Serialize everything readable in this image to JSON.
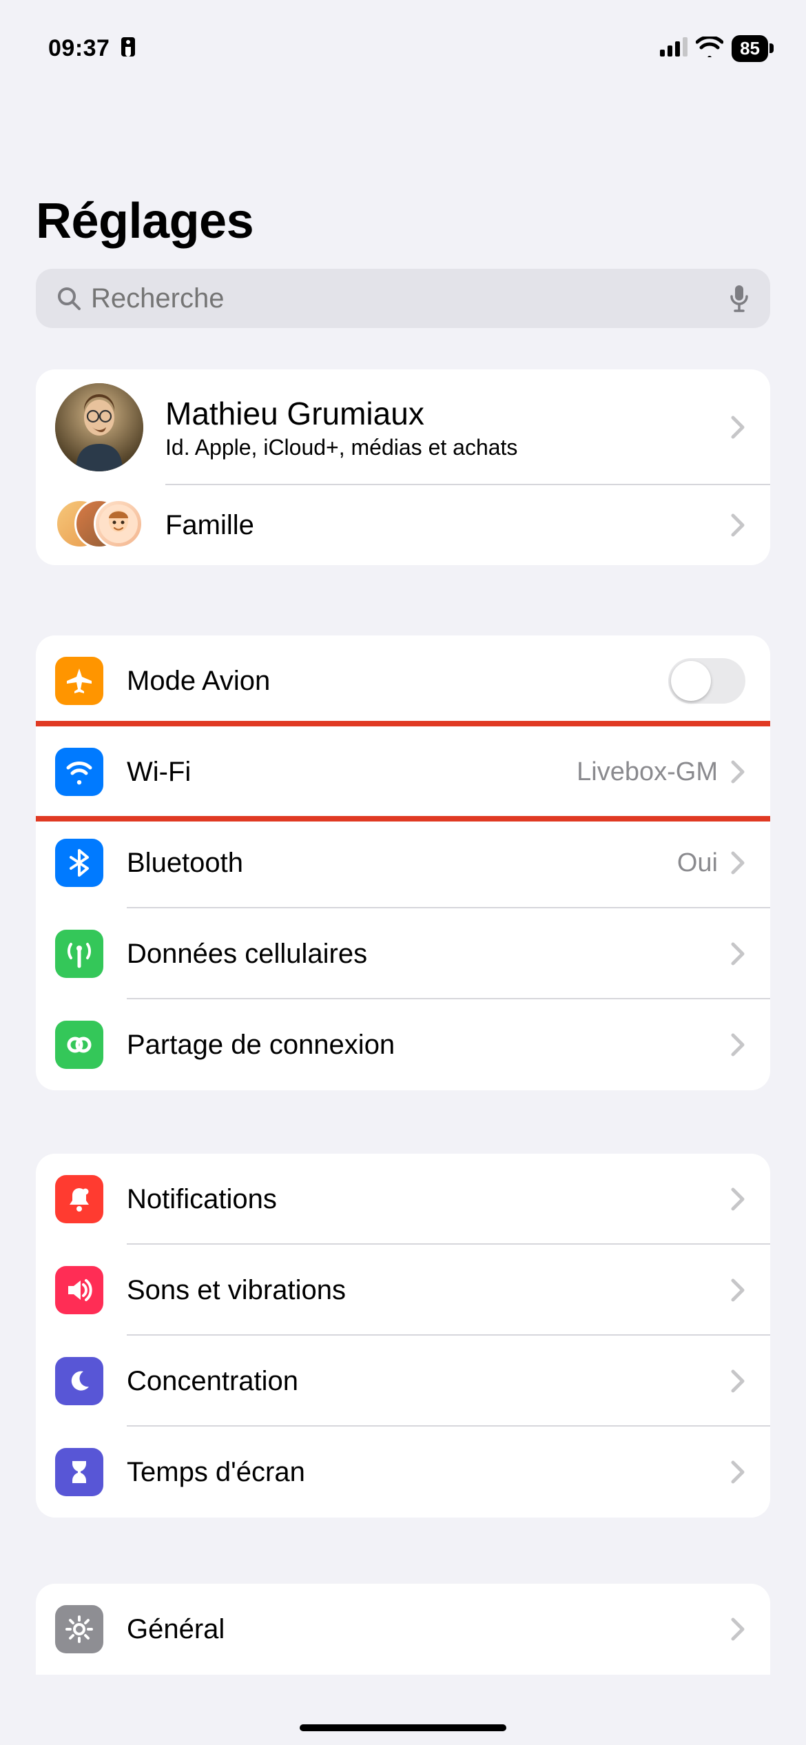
{
  "status": {
    "time": "09:37",
    "battery": "85"
  },
  "title": "Réglages",
  "search": {
    "placeholder": "Recherche"
  },
  "profile": {
    "name": "Mathieu Grumiaux",
    "subtitle": "Id. Apple, iCloud+, médias et achats",
    "family_label": "Famille"
  },
  "connectivity": {
    "airplane": "Mode Avion",
    "wifi": {
      "label": "Wi-Fi",
      "value": "Livebox-GM"
    },
    "bluetooth": {
      "label": "Bluetooth",
      "value": "Oui"
    },
    "cellular": "Données cellulaires",
    "hotspot": "Partage de connexion"
  },
  "attention": {
    "notifications": "Notifications",
    "sounds": "Sons et vibrations",
    "focus": "Concentration",
    "screentime": "Temps d'écran"
  },
  "general": {
    "general": "Général"
  },
  "airplane_on": false
}
